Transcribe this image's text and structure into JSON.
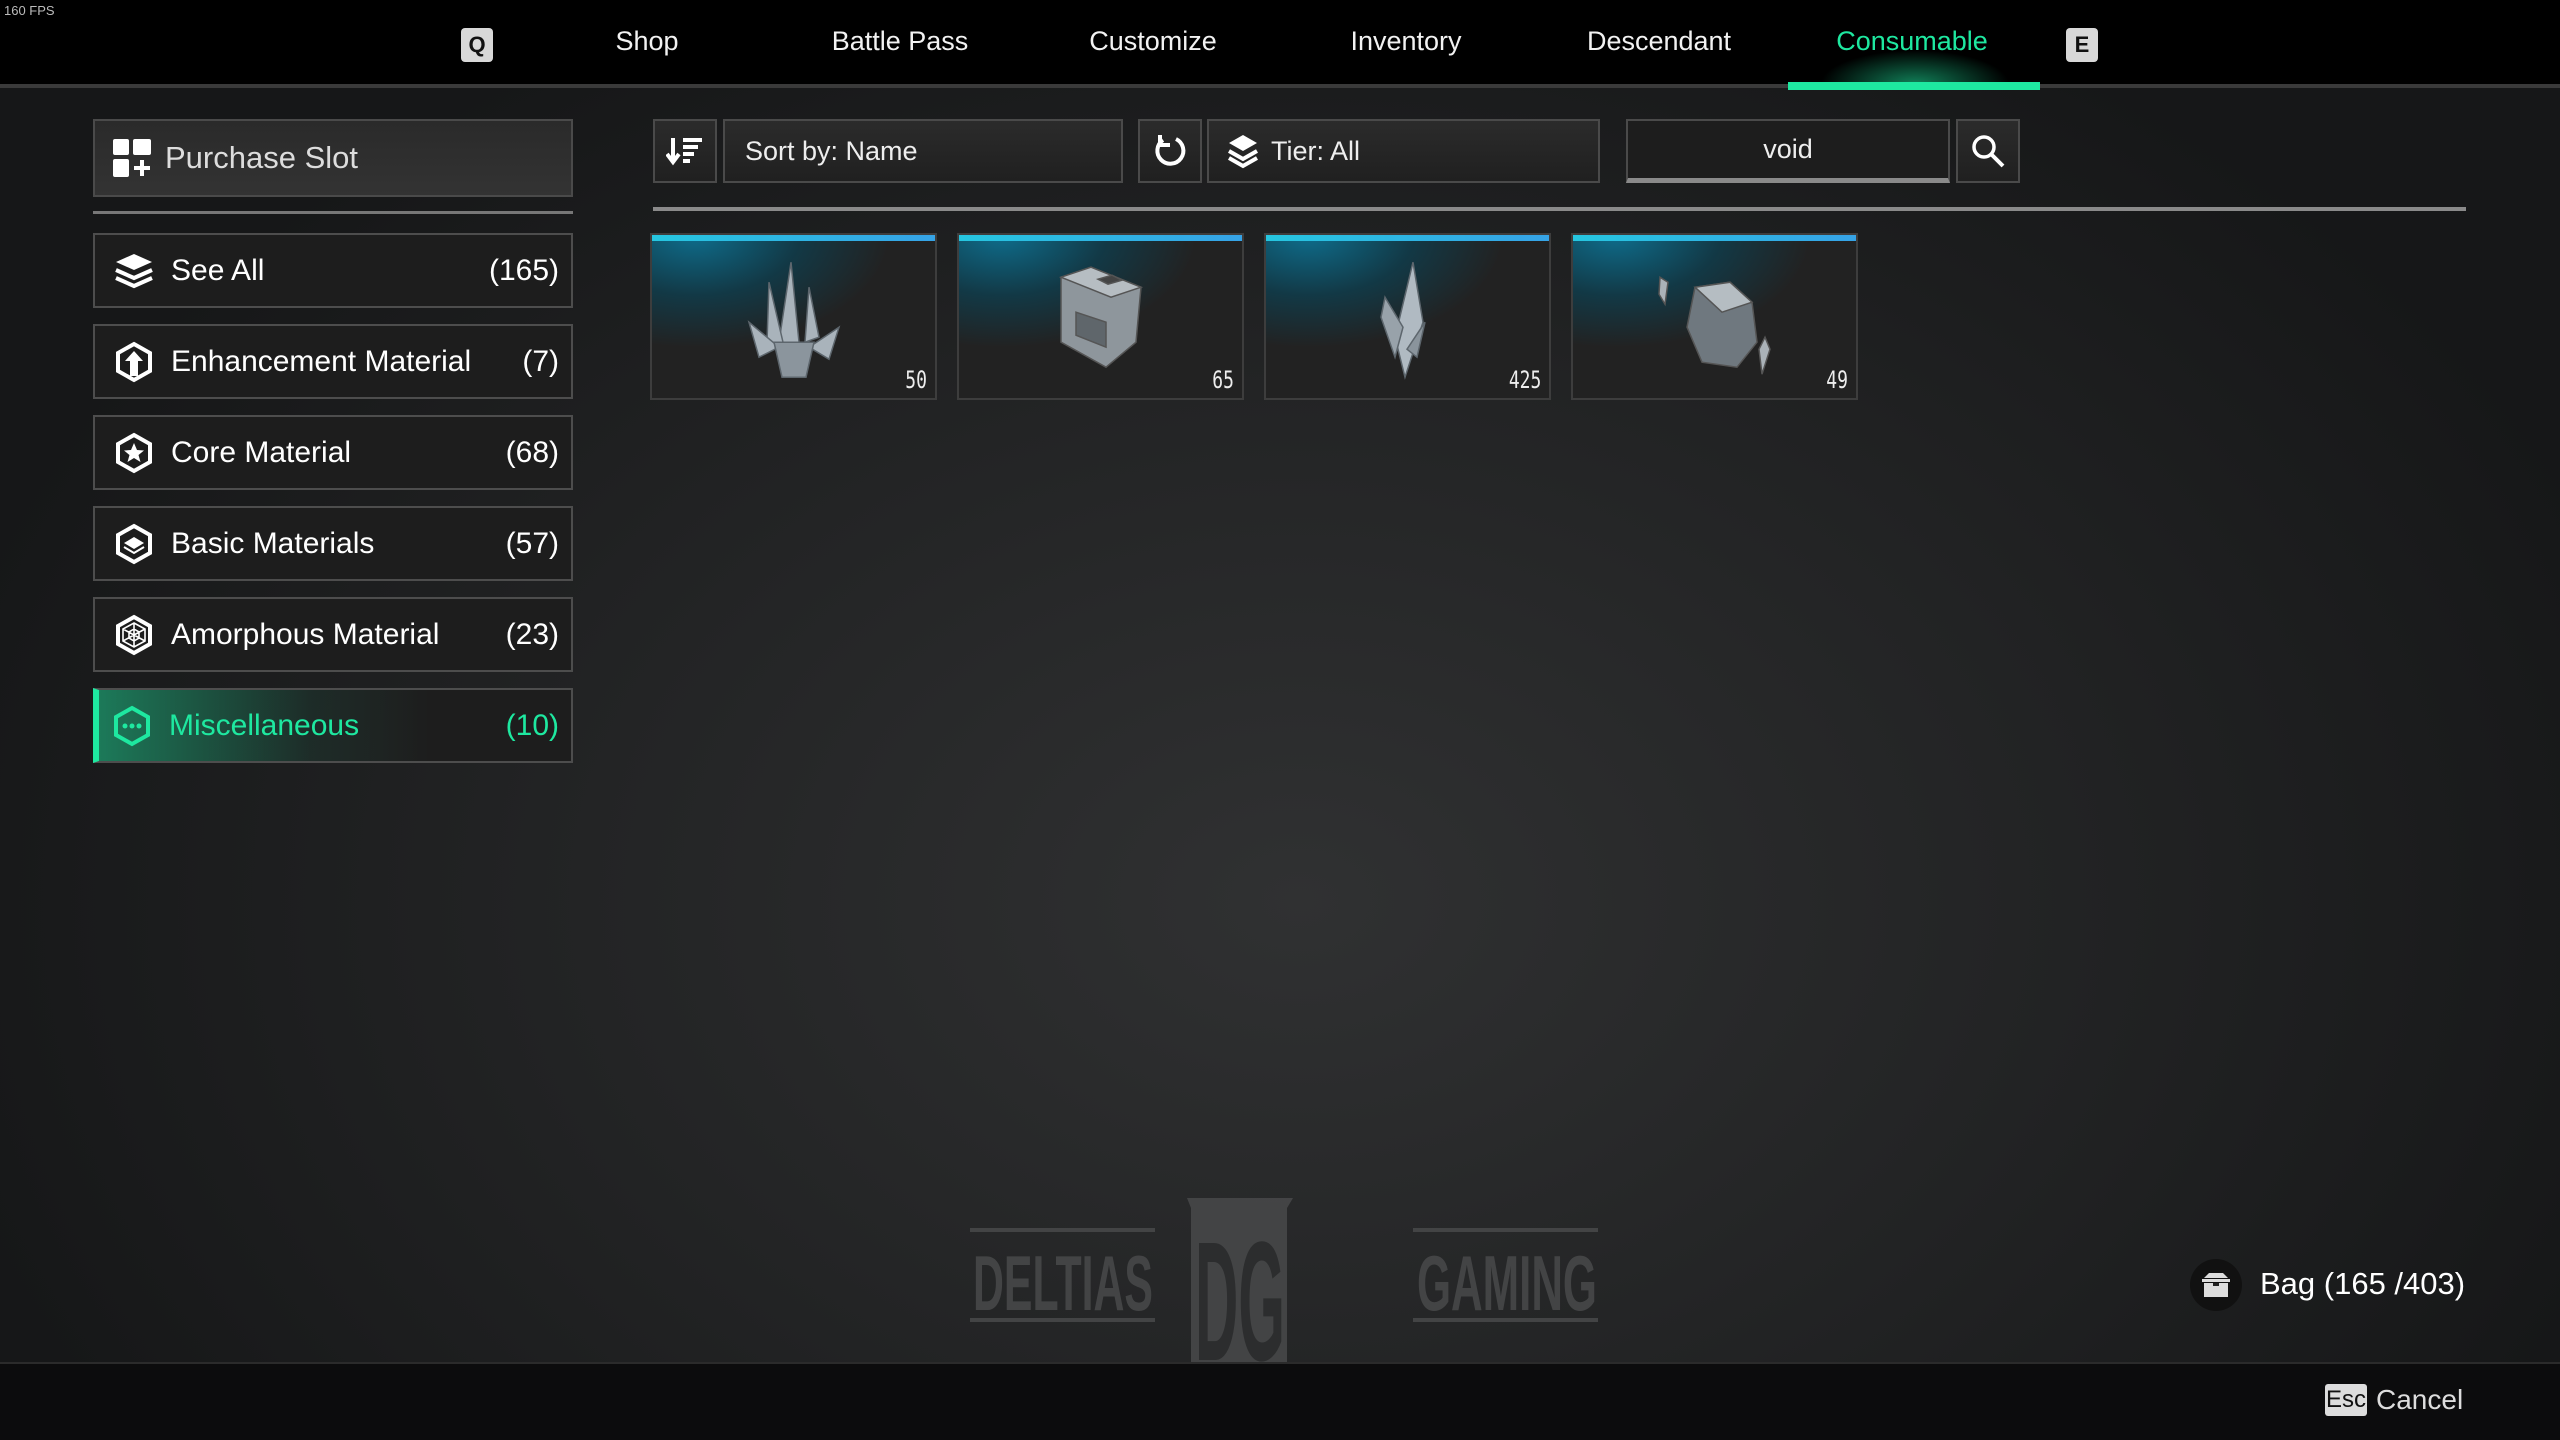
{
  "fps": "160 FPS",
  "nav": {
    "prev_key": "Q",
    "next_key": "E",
    "tabs": [
      {
        "label": "Shop"
      },
      {
        "label": "Battle Pass"
      },
      {
        "label": "Customize"
      },
      {
        "label": "Inventory"
      },
      {
        "label": "Descendant"
      },
      {
        "label": "Consumable",
        "active": true
      }
    ]
  },
  "sidebar": {
    "purchase_slot": "Purchase Slot",
    "items": [
      {
        "label": "See All",
        "count": "(165)",
        "icon": "layers-icon"
      },
      {
        "label": "Enhancement Material",
        "count": "(7)",
        "icon": "hex-arrow-up-icon"
      },
      {
        "label": "Core Material",
        "count": "(68)",
        "icon": "hex-star-icon"
      },
      {
        "label": "Basic Materials",
        "count": "(57)",
        "icon": "hex-layer-icon"
      },
      {
        "label": "Amorphous Material",
        "count": "(23)",
        "icon": "hex-web-icon"
      },
      {
        "label": "Miscellaneous",
        "count": "(10)",
        "icon": "hex-dots-icon",
        "active": true
      }
    ]
  },
  "toolbar": {
    "sort_label": "Sort by: Name",
    "tier_label": "Tier: All",
    "search_value": "void"
  },
  "items": [
    {
      "qty": "50",
      "icon": "crystal-cluster-icon"
    },
    {
      "qty": "65",
      "icon": "metal-block-icon"
    },
    {
      "qty": "425",
      "icon": "crystal-shard-icon"
    },
    {
      "qty": "49",
      "icon": "faceted-stone-icon"
    }
  ],
  "bag": {
    "label": "Bag (165 /403)"
  },
  "footer": {
    "esc_key": "Esc",
    "cancel_label": "Cancel"
  },
  "watermark": {
    "text_left": "DELTIAS",
    "text_right": "GAMING",
    "monogram": "DG"
  },
  "colors": {
    "accent": "#1ee8a0",
    "tier_bar": "#26c6e0"
  }
}
